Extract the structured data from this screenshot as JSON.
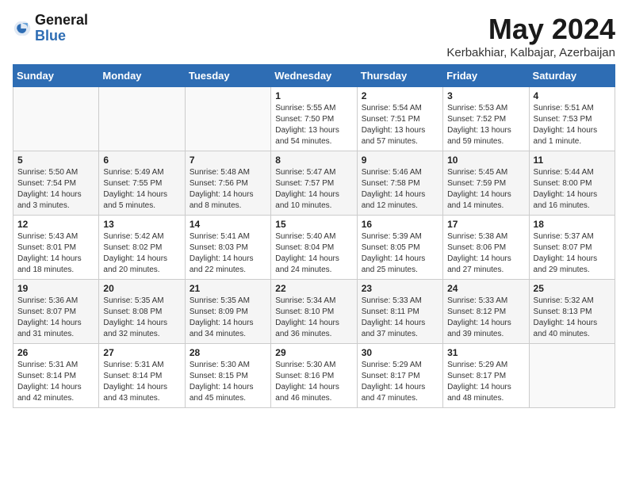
{
  "logo": {
    "general": "General",
    "blue": "Blue"
  },
  "title": "May 2024",
  "subtitle": "Kerbakhiar, Kalbajar, Azerbaijan",
  "days_of_week": [
    "Sunday",
    "Monday",
    "Tuesday",
    "Wednesday",
    "Thursday",
    "Friday",
    "Saturday"
  ],
  "weeks": [
    [
      {
        "day": "",
        "info": ""
      },
      {
        "day": "",
        "info": ""
      },
      {
        "day": "",
        "info": ""
      },
      {
        "day": "1",
        "info": "Sunrise: 5:55 AM\nSunset: 7:50 PM\nDaylight: 13 hours\nand 54 minutes."
      },
      {
        "day": "2",
        "info": "Sunrise: 5:54 AM\nSunset: 7:51 PM\nDaylight: 13 hours\nand 57 minutes."
      },
      {
        "day": "3",
        "info": "Sunrise: 5:53 AM\nSunset: 7:52 PM\nDaylight: 13 hours\nand 59 minutes."
      },
      {
        "day": "4",
        "info": "Sunrise: 5:51 AM\nSunset: 7:53 PM\nDaylight: 14 hours\nand 1 minute."
      }
    ],
    [
      {
        "day": "5",
        "info": "Sunrise: 5:50 AM\nSunset: 7:54 PM\nDaylight: 14 hours\nand 3 minutes."
      },
      {
        "day": "6",
        "info": "Sunrise: 5:49 AM\nSunset: 7:55 PM\nDaylight: 14 hours\nand 5 minutes."
      },
      {
        "day": "7",
        "info": "Sunrise: 5:48 AM\nSunset: 7:56 PM\nDaylight: 14 hours\nand 8 minutes."
      },
      {
        "day": "8",
        "info": "Sunrise: 5:47 AM\nSunset: 7:57 PM\nDaylight: 14 hours\nand 10 minutes."
      },
      {
        "day": "9",
        "info": "Sunrise: 5:46 AM\nSunset: 7:58 PM\nDaylight: 14 hours\nand 12 minutes."
      },
      {
        "day": "10",
        "info": "Sunrise: 5:45 AM\nSunset: 7:59 PM\nDaylight: 14 hours\nand 14 minutes."
      },
      {
        "day": "11",
        "info": "Sunrise: 5:44 AM\nSunset: 8:00 PM\nDaylight: 14 hours\nand 16 minutes."
      }
    ],
    [
      {
        "day": "12",
        "info": "Sunrise: 5:43 AM\nSunset: 8:01 PM\nDaylight: 14 hours\nand 18 minutes."
      },
      {
        "day": "13",
        "info": "Sunrise: 5:42 AM\nSunset: 8:02 PM\nDaylight: 14 hours\nand 20 minutes."
      },
      {
        "day": "14",
        "info": "Sunrise: 5:41 AM\nSunset: 8:03 PM\nDaylight: 14 hours\nand 22 minutes."
      },
      {
        "day": "15",
        "info": "Sunrise: 5:40 AM\nSunset: 8:04 PM\nDaylight: 14 hours\nand 24 minutes."
      },
      {
        "day": "16",
        "info": "Sunrise: 5:39 AM\nSunset: 8:05 PM\nDaylight: 14 hours\nand 25 minutes."
      },
      {
        "day": "17",
        "info": "Sunrise: 5:38 AM\nSunset: 8:06 PM\nDaylight: 14 hours\nand 27 minutes."
      },
      {
        "day": "18",
        "info": "Sunrise: 5:37 AM\nSunset: 8:07 PM\nDaylight: 14 hours\nand 29 minutes."
      }
    ],
    [
      {
        "day": "19",
        "info": "Sunrise: 5:36 AM\nSunset: 8:07 PM\nDaylight: 14 hours\nand 31 minutes."
      },
      {
        "day": "20",
        "info": "Sunrise: 5:35 AM\nSunset: 8:08 PM\nDaylight: 14 hours\nand 32 minutes."
      },
      {
        "day": "21",
        "info": "Sunrise: 5:35 AM\nSunset: 8:09 PM\nDaylight: 14 hours\nand 34 minutes."
      },
      {
        "day": "22",
        "info": "Sunrise: 5:34 AM\nSunset: 8:10 PM\nDaylight: 14 hours\nand 36 minutes."
      },
      {
        "day": "23",
        "info": "Sunrise: 5:33 AM\nSunset: 8:11 PM\nDaylight: 14 hours\nand 37 minutes."
      },
      {
        "day": "24",
        "info": "Sunrise: 5:33 AM\nSunset: 8:12 PM\nDaylight: 14 hours\nand 39 minutes."
      },
      {
        "day": "25",
        "info": "Sunrise: 5:32 AM\nSunset: 8:13 PM\nDaylight: 14 hours\nand 40 minutes."
      }
    ],
    [
      {
        "day": "26",
        "info": "Sunrise: 5:31 AM\nSunset: 8:14 PM\nDaylight: 14 hours\nand 42 minutes."
      },
      {
        "day": "27",
        "info": "Sunrise: 5:31 AM\nSunset: 8:14 PM\nDaylight: 14 hours\nand 43 minutes."
      },
      {
        "day": "28",
        "info": "Sunrise: 5:30 AM\nSunset: 8:15 PM\nDaylight: 14 hours\nand 45 minutes."
      },
      {
        "day": "29",
        "info": "Sunrise: 5:30 AM\nSunset: 8:16 PM\nDaylight: 14 hours\nand 46 minutes."
      },
      {
        "day": "30",
        "info": "Sunrise: 5:29 AM\nSunset: 8:17 PM\nDaylight: 14 hours\nand 47 minutes."
      },
      {
        "day": "31",
        "info": "Sunrise: 5:29 AM\nSunset: 8:17 PM\nDaylight: 14 hours\nand 48 minutes."
      },
      {
        "day": "",
        "info": ""
      }
    ]
  ]
}
